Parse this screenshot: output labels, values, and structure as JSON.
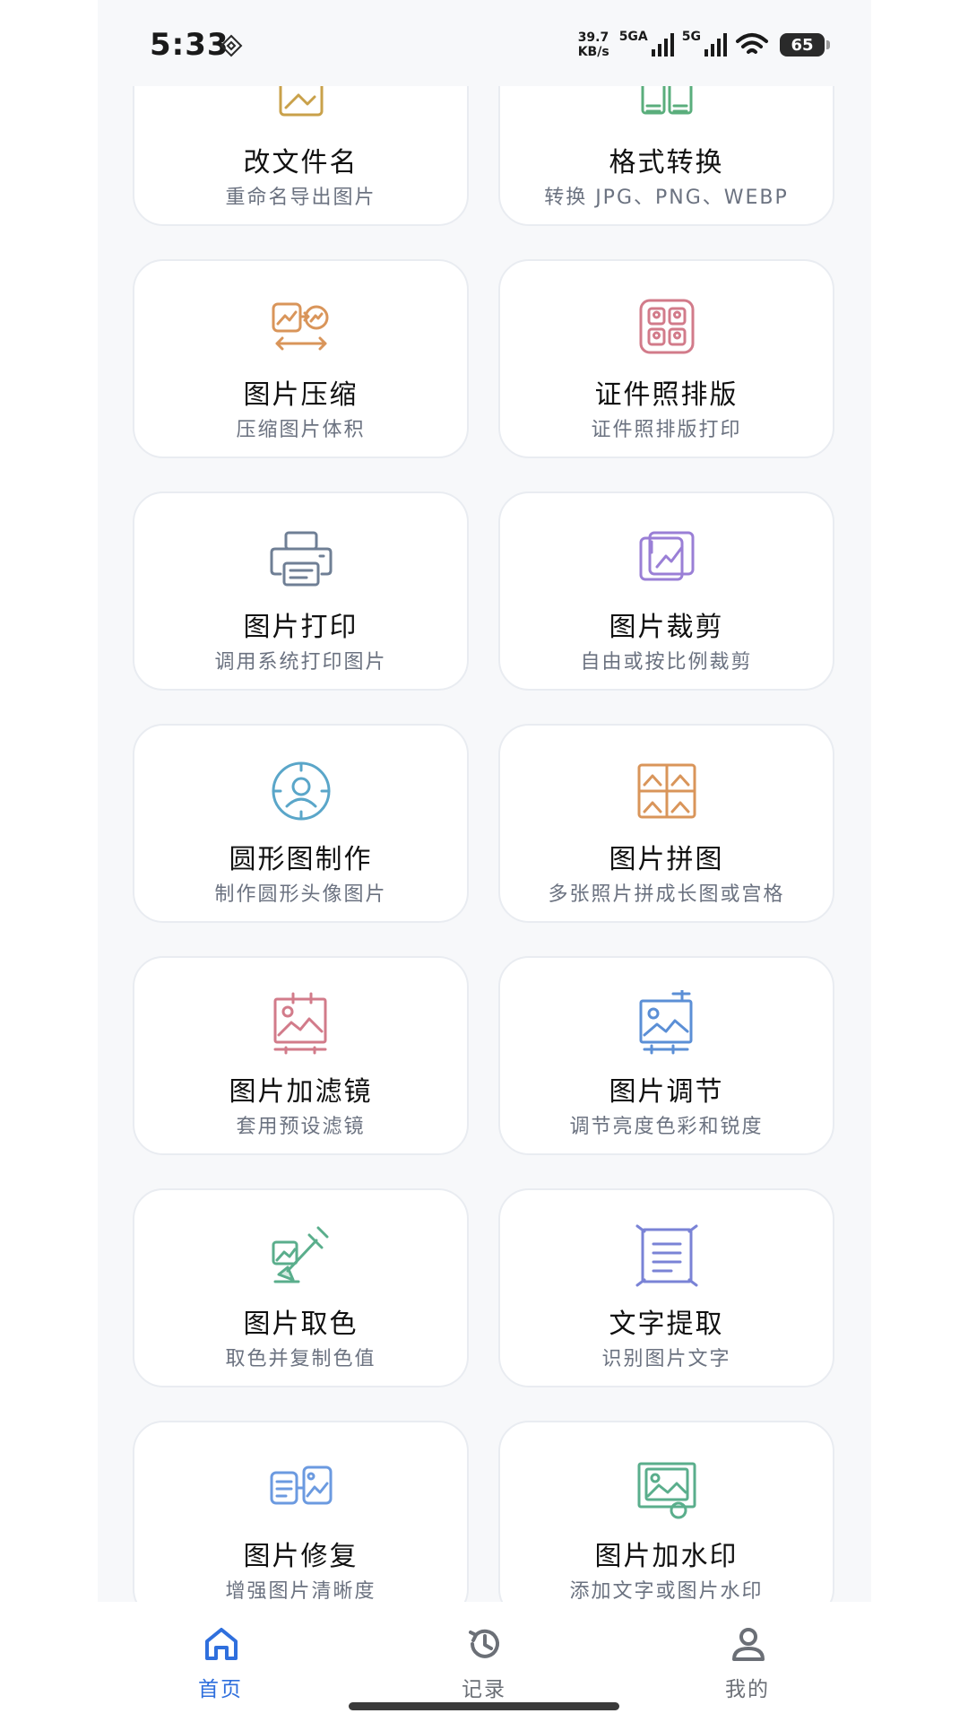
{
  "status_bar": {
    "time": "5:33",
    "net_speed_value": "39.7",
    "net_speed_unit": "KB/s",
    "sim1_label": "5GA",
    "sim2_label": "5G",
    "battery": "65",
    "icons": [
      "nfc-icon",
      "signal-icon",
      "wifi-icon",
      "battery-icon"
    ]
  },
  "tools": [
    {
      "title": "改文件名",
      "subtitle": "重命名导出图片",
      "icon": "rename-icon",
      "color": "#c9a14a"
    },
    {
      "title": "格式转换",
      "subtitle": "转换 JPG、PNG、WEBP",
      "icon": "format-convert-icon",
      "color": "#5aae7c"
    },
    {
      "title": "图片压缩",
      "subtitle": "压缩图片体积",
      "icon": "compress-icon",
      "color": "#d9955a"
    },
    {
      "title": "证件照排版",
      "subtitle": "证件照排版打印",
      "icon": "id-photo-icon",
      "color": "#d27b8a"
    },
    {
      "title": "图片打印",
      "subtitle": "调用系统打印图片",
      "icon": "printer-icon",
      "color": "#6f7f95"
    },
    {
      "title": "图片裁剪",
      "subtitle": "自由或按比例裁剪",
      "icon": "crop-icon",
      "color": "#9a7fd6"
    },
    {
      "title": "圆形图制作",
      "subtitle": "制作圆形头像图片",
      "icon": "circle-avatar-icon",
      "color": "#5aa6c9"
    },
    {
      "title": "图片拼图",
      "subtitle": "多张照片拼成长图或宫格",
      "icon": "collage-icon",
      "color": "#d9955a"
    },
    {
      "title": "图片加滤镜",
      "subtitle": "套用预设滤镜",
      "icon": "filter-icon",
      "color": "#d27b8a"
    },
    {
      "title": "图片调节",
      "subtitle": "调节亮度色彩和锐度",
      "icon": "adjust-icon",
      "color": "#5b8fd6"
    },
    {
      "title": "图片取色",
      "subtitle": "取色并复制色值",
      "icon": "color-picker-icon",
      "color": "#5aae8c"
    },
    {
      "title": "文字提取",
      "subtitle": "识别图片文字",
      "icon": "text-extract-icon",
      "color": "#7a83d6"
    },
    {
      "title": "图片修复",
      "subtitle": "增强图片清晰度",
      "icon": "restore-icon",
      "color": "#6b9ae0"
    },
    {
      "title": "图片加水印",
      "subtitle": "添加文字或图片水印",
      "icon": "watermark-icon",
      "color": "#5aae8c"
    }
  ],
  "bottom_nav": [
    {
      "label": "首页",
      "icon": "home-icon",
      "active": true
    },
    {
      "label": "记录",
      "icon": "history-icon",
      "active": false
    },
    {
      "label": "我的",
      "icon": "profile-icon",
      "active": false
    }
  ],
  "colors": {
    "accent": "#2f6fdd",
    "background": "#f7f8fa",
    "card": "#ffffff",
    "subtitle": "#6b7280"
  }
}
